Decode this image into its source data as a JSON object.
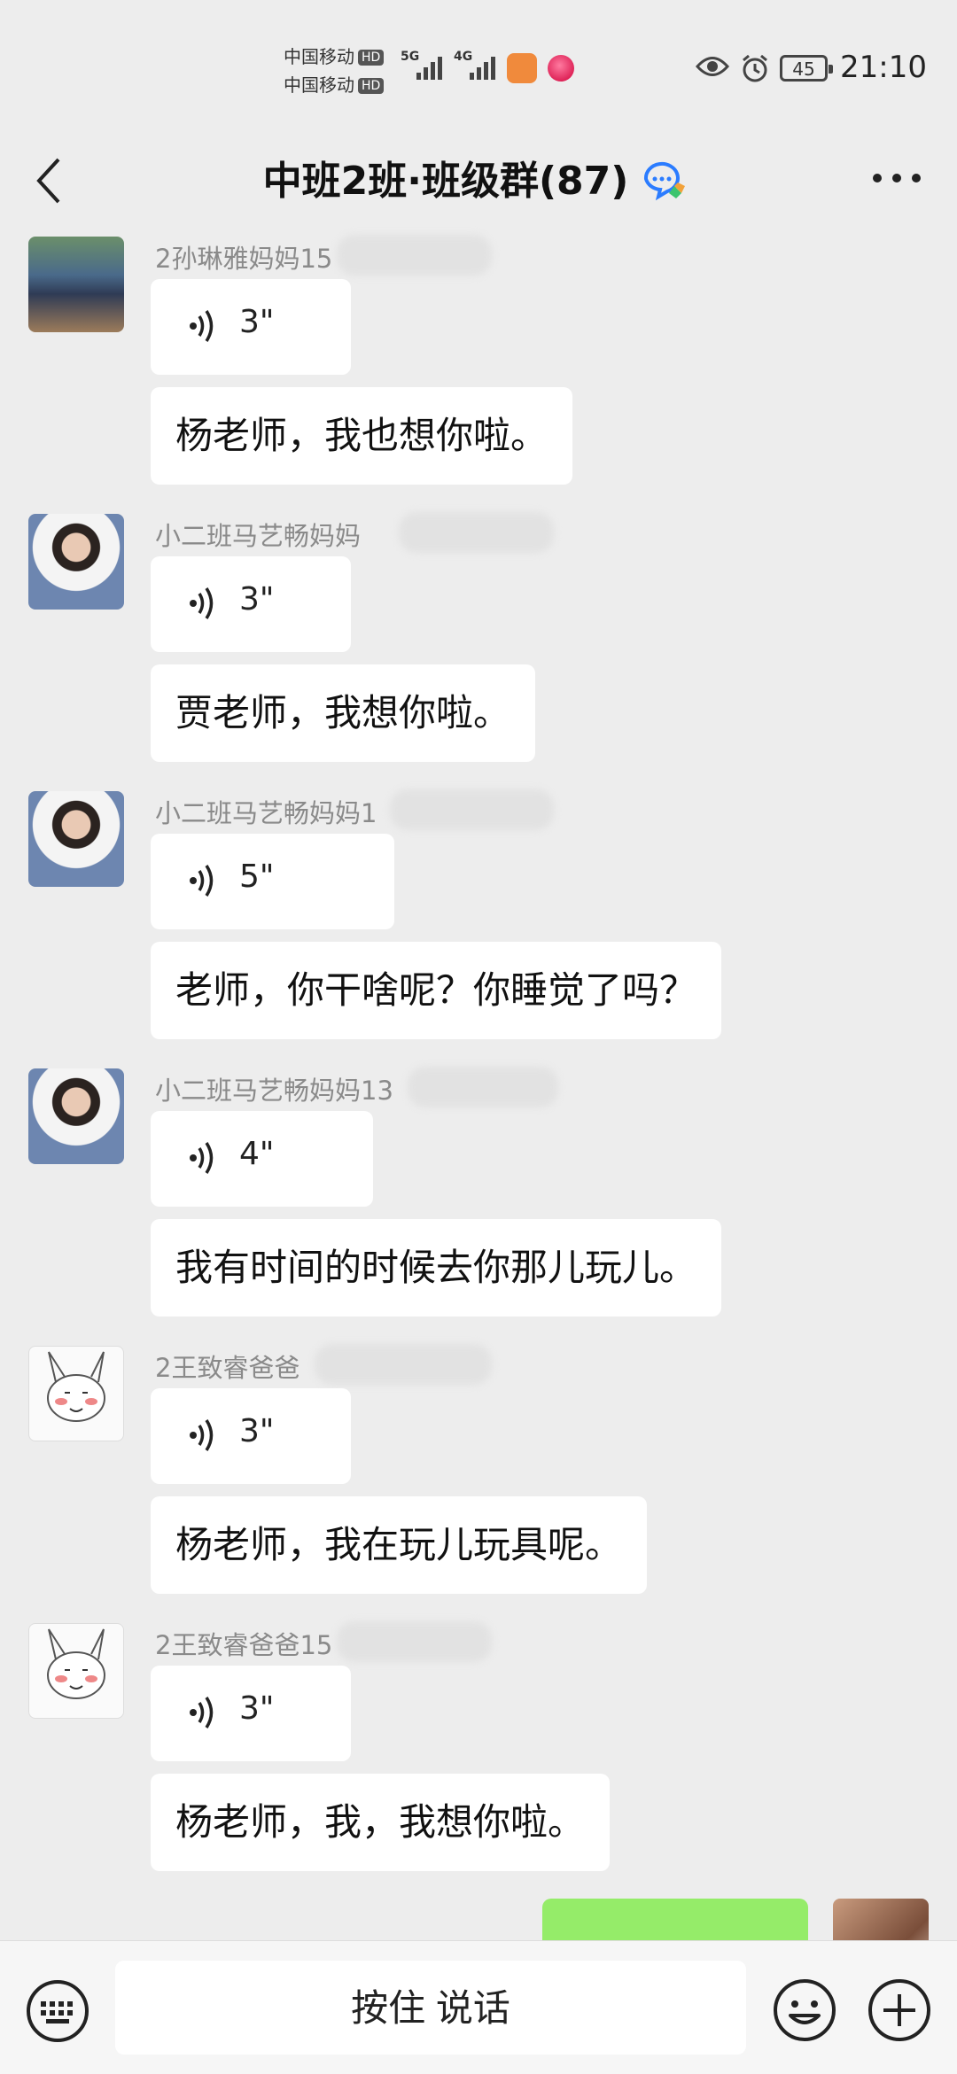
{
  "status": {
    "carrier1": "中国移动",
    "carrier2": "中国移动",
    "hd": "HD",
    "net1": "5G",
    "net2": "4G",
    "battery": "45",
    "time": "21:10"
  },
  "nav": {
    "title": "中班2班·班级群(87)"
  },
  "messages": [
    {
      "sender": "2孙琳雅妈妈15",
      "voice": "3\"",
      "text": "杨老师，我也想你啦。"
    },
    {
      "sender": "小二班马艺畅妈妈",
      "voice": "3\"",
      "text": "贾老师，我想你啦。"
    },
    {
      "sender": "小二班马艺畅妈妈1",
      "voice": "5\"",
      "text": "老师，你干啥呢？你睡觉了吗？"
    },
    {
      "sender": "小二班马艺畅妈妈13",
      "voice": "4\"",
      "text": "我有时间的时候去你那儿玩儿。"
    },
    {
      "sender": "2王致睿爸爸",
      "voice": "3\"",
      "text": "杨老师，我在玩儿玩具呢。"
    },
    {
      "sender": "2王致睿爸爸15",
      "voice": "3\"",
      "text": "杨老师，我，我想你啦。"
    }
  ],
  "input": {
    "talk_label": "按住 说话"
  },
  "icons": {
    "back": "back-arrow-icon",
    "more": "more-icon",
    "keyboard": "keyboard-icon",
    "emoji": "emoji-icon",
    "plus": "plus-icon",
    "voice": "voice-wave-icon",
    "group": "group-chat-icon"
  },
  "colors": {
    "background": "#ededed",
    "incoming_bubble": "#ffffff",
    "outgoing_bubble": "#95ec69",
    "sender_text": "#8a8a8a"
  }
}
